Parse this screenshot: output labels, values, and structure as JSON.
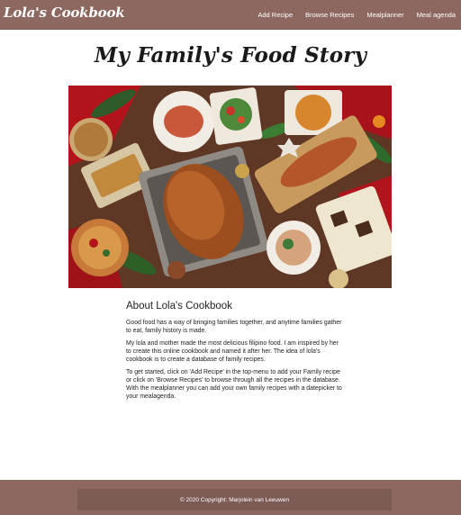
{
  "navbar": {
    "brand": "Lola's Cookbook",
    "links": [
      {
        "label": "Add Recipe"
      },
      {
        "label": "Browse Recipes"
      },
      {
        "label": "Mealplanner"
      },
      {
        "label": "Meal agenda"
      }
    ]
  },
  "page": {
    "title": "My Family's Food Story"
  },
  "about": {
    "heading": "About Lola's Cookbook",
    "paragraphs": [
      "Good food has a way of bringing families together, and anytime families gather to eat, family history is made.",
      "My lola and mother made the most delicious filipino food. I am inspired by her to create this online cookbook and named it after her. The idea of lola's cookbook is to create a database of family recipes.",
      "To get started, click on 'Add Recipe' in the top-menu to add your Family recipe or click on 'Browse Recipes' to browse through all the recipes in the database. With the mealplanner you can add your own family recipes with a datepicker to your mealagenda."
    ]
  },
  "footer": {
    "copyright": "© 2020 Copyright: Marjolein van Leeuwen"
  },
  "colors": {
    "nav_bg": "#8d6861",
    "footer_inner_bg": "#7d5b55",
    "text": "#222222"
  }
}
